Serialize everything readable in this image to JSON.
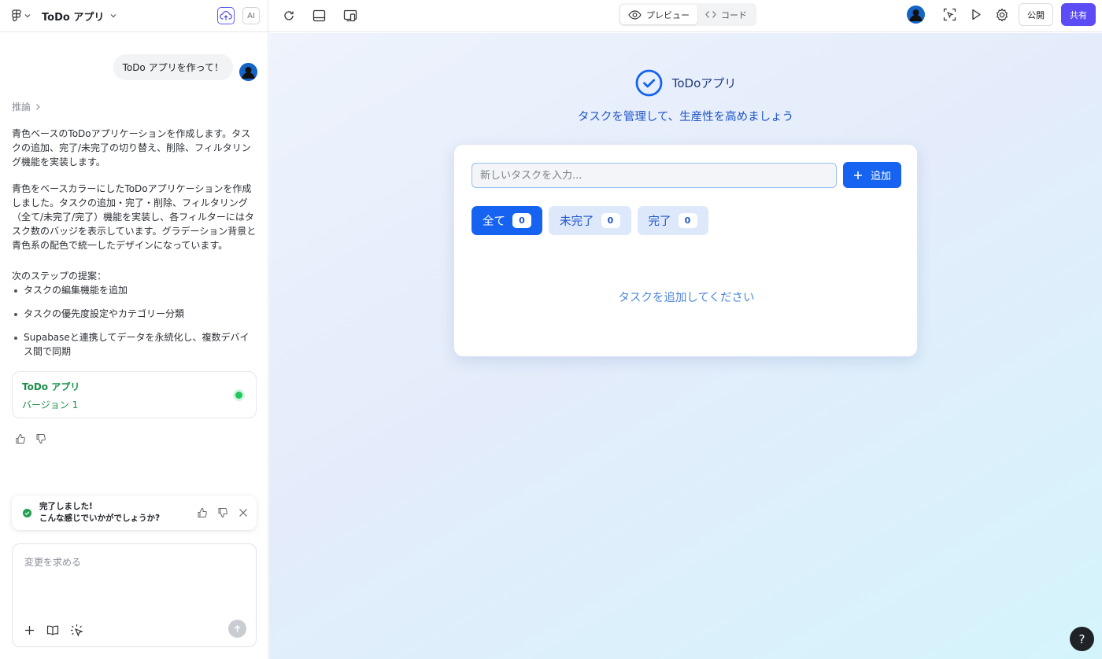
{
  "sidebar": {
    "project_title": "ToDo アプリ",
    "ai_label": "AI",
    "user_message": "ToDo アプリを作って！",
    "reasoning_label": "推論",
    "paragraph1": "青色ベースのToDoアプリケーションを作成します。タスクの追加、完了/未完了の切り替え、削除、フィルタリング機能を実装します。",
    "paragraph2": "青色をベースカラーにしたToDoアプリケーションを作成しました。タスクの追加・完了・削除、フィルタリング（全て/未完了/完了）機能を実装し、各フィルターにはタスク数のバッジを表示しています。グラデーション背景と青色系の配色で統一したデザインになっています。",
    "steps_title": "次のステップの提案：",
    "steps": [
      "タスクの編集機能を追加",
      "タスクの優先度設定やカテゴリー分類",
      "Supabaseと連携してデータを永続化し、複数デバイス間で同期"
    ],
    "version_card": {
      "title": "ToDo アプリ",
      "version": "バージョン 1"
    },
    "toast": {
      "line1": "完了しました!",
      "line2": "こんな感じでいかがでしょうか?"
    },
    "composer": {
      "placeholder": "変更を求める"
    }
  },
  "topbar": {
    "preview_label": "プレビュー",
    "code_label": "コード",
    "publish_label": "公開",
    "share_label": "共有"
  },
  "preview": {
    "app_title": "ToDoアプリ",
    "app_subtitle": "タスクを管理して、生産性を高めましょう",
    "input_placeholder": "新しいタスクを入力...",
    "add_label": "追加",
    "filters": [
      {
        "label": "全て",
        "count": "0"
      },
      {
        "label": "未完了",
        "count": "0"
      },
      {
        "label": "完了",
        "count": "0"
      }
    ],
    "empty_message": "タスクを追加してください",
    "help_label": "?"
  },
  "colors": {
    "primary": "#1563f0",
    "accent": "#5b4cf5",
    "success": "#22a052"
  }
}
